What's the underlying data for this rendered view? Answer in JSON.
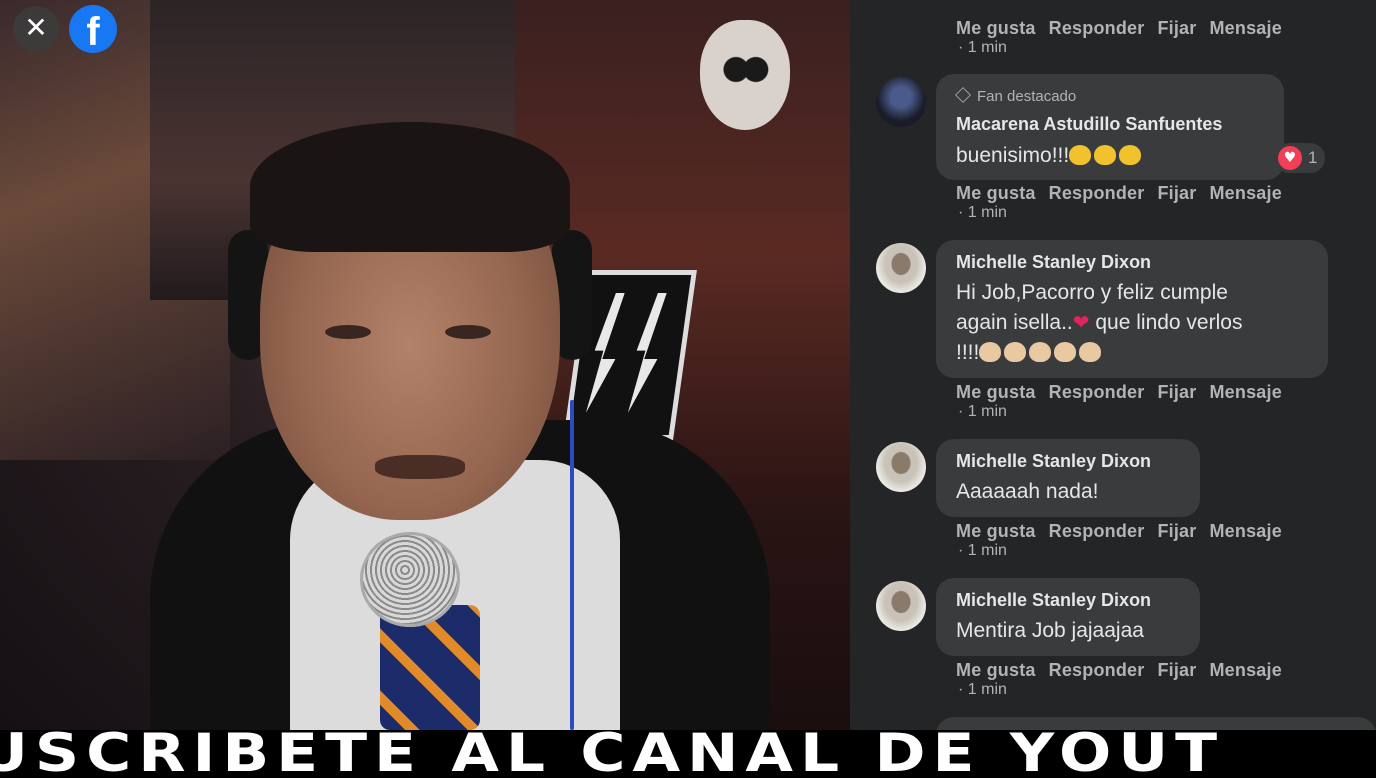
{
  "banner": {
    "text": "USCRÍBETE AL CANAL DE YOUT"
  },
  "icons": {
    "close": "close-icon",
    "brand": "facebook-logo-icon",
    "badge": "diamond-icon",
    "reaction": "heart-icon"
  },
  "colors": {
    "panel_bg": "#242526",
    "bubble_bg": "#3a3b3c",
    "text": "#e4e6eb",
    "muted": "#b0b3b8",
    "facebook_blue": "#1877f2",
    "reaction_red": "#f33e58"
  },
  "actions": {
    "like": "Me gusta",
    "reply": "Responder",
    "pin": "Fijar",
    "message": "Mensaje"
  },
  "top_partial": {
    "time": "· 1 min"
  },
  "comments": [
    {
      "badge": "Fan destacado",
      "name": "Macarena Astudillo Sanfuentes",
      "text_lines": [
        "buenisimo!!!"
      ],
      "reaction_count": "1",
      "time": "· 1 min"
    },
    {
      "name": "Michelle Stanley Dixon",
      "text_lines": [
        "Hi Job,Pacorro y feliz cumple",
        "again isella..",
        "que lindo verlos",
        "!!!!"
      ],
      "time": "· 1 min"
    },
    {
      "name": "Michelle Stanley Dixon",
      "text_lines": [
        "Aaaaaah nada!"
      ],
      "time": "· 1 min"
    },
    {
      "name": "Michelle Stanley Dixon",
      "text_lines": [
        "Mentira Job jajaajaa"
      ],
      "time": "· 1 min"
    }
  ]
}
